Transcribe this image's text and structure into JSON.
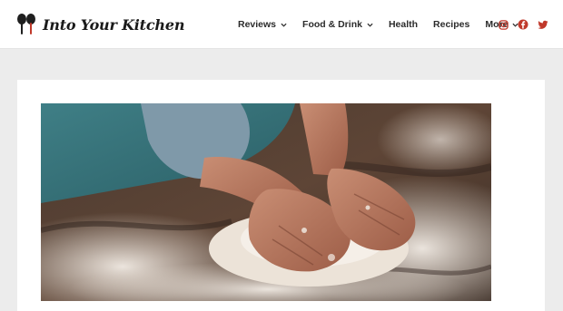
{
  "site": {
    "name": "Into Your Kitchen"
  },
  "nav": {
    "items": [
      {
        "label": "Reviews",
        "has_dropdown": true
      },
      {
        "label": "Food & Drink",
        "has_dropdown": true
      },
      {
        "label": "Health",
        "has_dropdown": false
      },
      {
        "label": "Recipes",
        "has_dropdown": false
      },
      {
        "label": "More",
        "has_dropdown": true
      }
    ]
  },
  "social": {
    "icons": [
      "instagram-icon",
      "facebook-icon",
      "twitter-icon"
    ],
    "color": "#c0392b"
  },
  "article": {
    "hero_image": "hands-kneading-dough-on-floured-table"
  },
  "colors": {
    "accent": "#c0392b",
    "header_bg": "#ffffff",
    "page_bg": "#ececec",
    "text": "#2b2b2b"
  }
}
